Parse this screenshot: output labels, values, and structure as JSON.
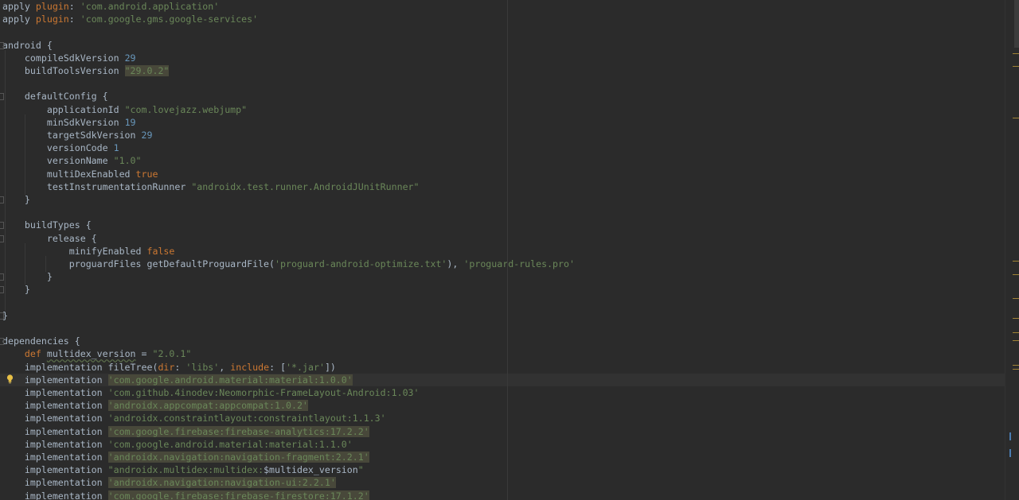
{
  "editor": {
    "lines": [
      {
        "tokens": [
          {
            "t": "apply ",
            "c": "plain"
          },
          {
            "t": "plugin",
            "c": "kw"
          },
          {
            "t": ": ",
            "c": "plain"
          },
          {
            "t": "'com.android.application'",
            "c": "str"
          }
        ]
      },
      {
        "tokens": [
          {
            "t": "apply ",
            "c": "plain"
          },
          {
            "t": "plugin",
            "c": "kw"
          },
          {
            "t": ": ",
            "c": "plain"
          },
          {
            "t": "'com.google.gms.google-services'",
            "c": "str"
          }
        ]
      },
      {
        "tokens": []
      },
      {
        "tokens": [
          {
            "t": "android {",
            "c": "plain"
          }
        ]
      },
      {
        "tokens": [
          {
            "t": "    compileSdkVersion ",
            "c": "plain"
          },
          {
            "t": "29",
            "c": "num"
          }
        ]
      },
      {
        "tokens": [
          {
            "t": "    buildToolsVersion ",
            "c": "plain"
          },
          {
            "t": "\"29.0.2\"",
            "c": "str",
            "warn": true
          }
        ]
      },
      {
        "tokens": []
      },
      {
        "tokens": [
          {
            "t": "    defaultConfig {",
            "c": "plain"
          }
        ]
      },
      {
        "tokens": [
          {
            "t": "        applicationId ",
            "c": "plain"
          },
          {
            "t": "\"com.lovejazz.webjump\"",
            "c": "str"
          }
        ]
      },
      {
        "tokens": [
          {
            "t": "        minSdkVersion ",
            "c": "plain"
          },
          {
            "t": "19",
            "c": "num"
          }
        ]
      },
      {
        "tokens": [
          {
            "t": "        targetSdkVersion ",
            "c": "plain"
          },
          {
            "t": "29",
            "c": "num"
          }
        ]
      },
      {
        "tokens": [
          {
            "t": "        versionCode ",
            "c": "plain"
          },
          {
            "t": "1",
            "c": "num"
          }
        ]
      },
      {
        "tokens": [
          {
            "t": "        versionName ",
            "c": "plain"
          },
          {
            "t": "\"1.0\"",
            "c": "str"
          }
        ]
      },
      {
        "tokens": [
          {
            "t": "        multiDexEnabled ",
            "c": "plain"
          },
          {
            "t": "true",
            "c": "kw"
          }
        ]
      },
      {
        "tokens": [
          {
            "t": "        testInstrumentationRunner ",
            "c": "plain"
          },
          {
            "t": "\"androidx.test.runner.AndroidJUnitRunner\"",
            "c": "str"
          }
        ]
      },
      {
        "tokens": [
          {
            "t": "    }",
            "c": "plain"
          }
        ]
      },
      {
        "tokens": []
      },
      {
        "tokens": [
          {
            "t": "    buildTypes {",
            "c": "plain"
          }
        ]
      },
      {
        "tokens": [
          {
            "t": "        release {",
            "c": "plain"
          }
        ]
      },
      {
        "tokens": [
          {
            "t": "            minifyEnabled ",
            "c": "plain"
          },
          {
            "t": "false",
            "c": "kw"
          }
        ]
      },
      {
        "tokens": [
          {
            "t": "            proguardFiles getDefaultProguardFile(",
            "c": "plain"
          },
          {
            "t": "'proguard-android-optimize.txt'",
            "c": "str"
          },
          {
            "t": "), ",
            "c": "plain"
          },
          {
            "t": "'proguard-rules.pro'",
            "c": "str"
          }
        ]
      },
      {
        "tokens": [
          {
            "t": "        }",
            "c": "plain"
          }
        ]
      },
      {
        "tokens": [
          {
            "t": "    }",
            "c": "plain"
          }
        ]
      },
      {
        "tokens": []
      },
      {
        "tokens": [
          {
            "t": "}",
            "c": "plain"
          }
        ]
      },
      {
        "tokens": []
      },
      {
        "tokens": [
          {
            "t": "dependencies {",
            "c": "plain"
          }
        ]
      },
      {
        "tokens": [
          {
            "t": "    ",
            "c": "plain"
          },
          {
            "t": "def ",
            "c": "kw"
          },
          {
            "t": "multidex_version",
            "c": "plain",
            "under": true
          },
          {
            "t": " = ",
            "c": "plain"
          },
          {
            "t": "\"2.0.1\"",
            "c": "str"
          }
        ]
      },
      {
        "tokens": [
          {
            "t": "    implementation fileTree(",
            "c": "plain"
          },
          {
            "t": "dir",
            "c": "kw"
          },
          {
            "t": ": ",
            "c": "plain"
          },
          {
            "t": "'libs'",
            "c": "str"
          },
          {
            "t": ", ",
            "c": "plain"
          },
          {
            "t": "include",
            "c": "kw"
          },
          {
            "t": ": [",
            "c": "plain"
          },
          {
            "t": "'*.jar'",
            "c": "str"
          },
          {
            "t": "])",
            "c": "plain"
          }
        ]
      },
      {
        "caret": true,
        "tokens": [
          {
            "t": "    implementation ",
            "c": "plain"
          },
          {
            "t": "'com.google.android.material:material:1.0.0'",
            "c": "str",
            "warn": true
          }
        ]
      },
      {
        "tokens": [
          {
            "t": "    implementation ",
            "c": "plain"
          },
          {
            "t": "'com.github.4inodev:Neomorphic-FrameLayout-Android:1.03'",
            "c": "str"
          }
        ]
      },
      {
        "tokens": [
          {
            "t": "    implementation ",
            "c": "plain"
          },
          {
            "t": "'androidx.appcompat:appcompat:1.0.2'",
            "c": "str",
            "warn": true
          }
        ]
      },
      {
        "tokens": [
          {
            "t": "    implementation ",
            "c": "plain"
          },
          {
            "t": "'androidx.constraintlayout:constraintlayout:1.1.3'",
            "c": "str"
          }
        ]
      },
      {
        "tokens": [
          {
            "t": "    implementation ",
            "c": "plain"
          },
          {
            "t": "'com.google.firebase:firebase-analytics:17.2.2'",
            "c": "str",
            "warn": true
          }
        ]
      },
      {
        "tokens": [
          {
            "t": "    implementation ",
            "c": "plain"
          },
          {
            "t": "'com.google.android.material:material:1.1.0'",
            "c": "str"
          }
        ]
      },
      {
        "tokens": [
          {
            "t": "    implementation ",
            "c": "plain"
          },
          {
            "t": "'androidx.navigation:navigation-fragment:2.2.1'",
            "c": "str",
            "warn": true
          }
        ]
      },
      {
        "tokens": [
          {
            "t": "    implementation ",
            "c": "plain"
          },
          {
            "t": "\"androidx.multidex:multidex:",
            "c": "str"
          },
          {
            "t": "$multidex_version",
            "c": "plain"
          },
          {
            "t": "\"",
            "c": "str"
          }
        ]
      },
      {
        "tokens": [
          {
            "t": "    implementation ",
            "c": "plain"
          },
          {
            "t": "'androidx.navigation:navigation-ui:2.2.1'",
            "c": "str",
            "warn": true
          }
        ]
      },
      {
        "tokens": [
          {
            "t": "    implementation ",
            "c": "plain"
          },
          {
            "t": "'com.google.firebase:firebase-firestore:17.1.2'",
            "c": "str",
            "warn": true
          }
        ]
      }
    ]
  },
  "icons": {
    "intention": "lightbulb-icon"
  },
  "colors": {
    "background": "#2b2b2b",
    "keyword": "#cc7832",
    "string": "#6a8759",
    "number": "#6897bb",
    "text": "#a9b7c6",
    "warning_highlight": "#48483a",
    "caret_row": "#323232"
  }
}
